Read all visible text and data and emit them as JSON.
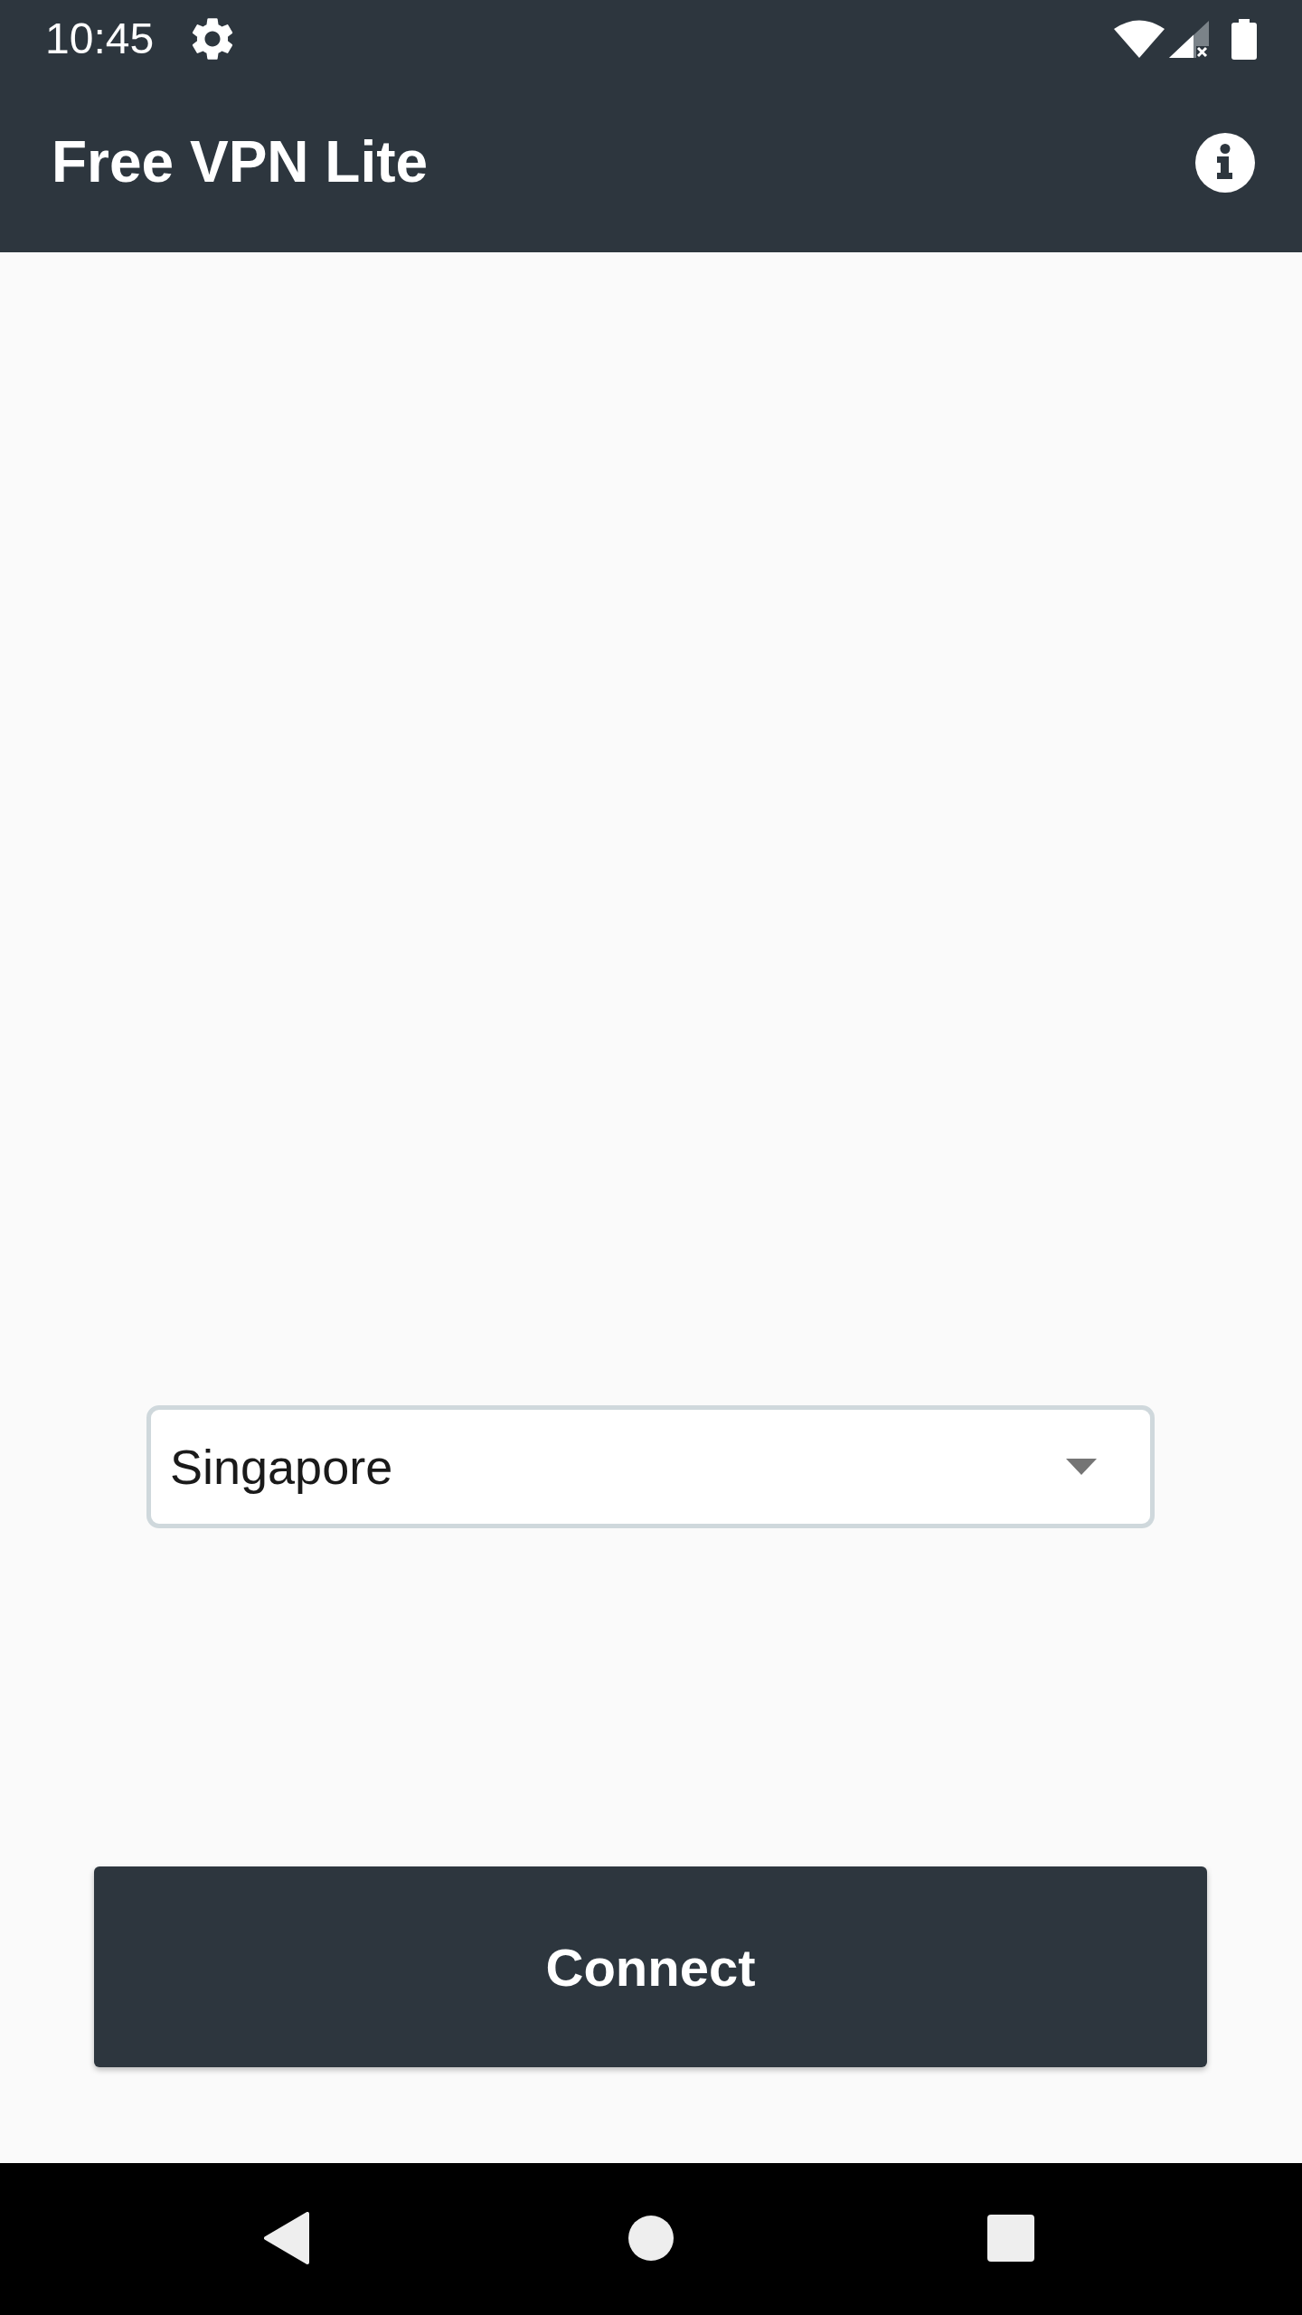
{
  "status_bar": {
    "time": "10:45"
  },
  "app_bar": {
    "title": "Free VPN Lite"
  },
  "country_select": {
    "value": "Singapore"
  },
  "connect_button": {
    "label": "Connect"
  }
}
